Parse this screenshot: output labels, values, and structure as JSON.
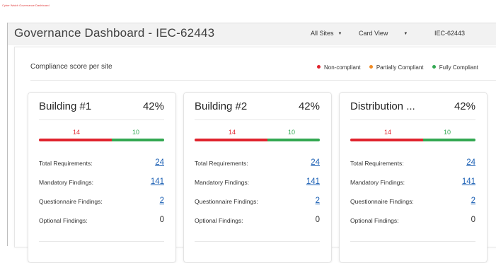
{
  "window": {
    "title": "Cyber Watch Governance Dashboard"
  },
  "header": {
    "title": "Governance Dashboard - IEC-62443",
    "site_filter": "All Sites",
    "view_select": "Card View",
    "standard": "IEC-62443"
  },
  "panel": {
    "title": "Compliance score per site",
    "legend": [
      {
        "label": "Non-compliant",
        "color": "#e0232d"
      },
      {
        "label": "Partially Compliant",
        "color": "#f08a24"
      },
      {
        "label": "Fully Compliant",
        "color": "#33a852"
      }
    ]
  },
  "labels": {
    "total": "Total Requirements:",
    "mandatory": "Mandatory Findings:",
    "questionnaire": "Questionnaire Findings:",
    "optional": "Optional Findings:"
  },
  "sites": [
    {
      "name": "Building #1",
      "percent": "42%",
      "non_compliant": "14",
      "fully_compliant": "10",
      "non_compliant_fraction": 0.58,
      "total": "24",
      "mandatory": "141",
      "questionnaire": "2",
      "optional": "0"
    },
    {
      "name": "Building #2",
      "percent": "42%",
      "non_compliant": "14",
      "fully_compliant": "10",
      "non_compliant_fraction": 0.58,
      "total": "24",
      "mandatory": "141",
      "questionnaire": "2",
      "optional": "0"
    },
    {
      "name": "Distribution ...",
      "percent": "42%",
      "non_compliant": "14",
      "fully_compliant": "10",
      "non_compliant_fraction": 0.58,
      "total": "24",
      "mandatory": "141",
      "questionnaire": "2",
      "optional": "0"
    }
  ]
}
